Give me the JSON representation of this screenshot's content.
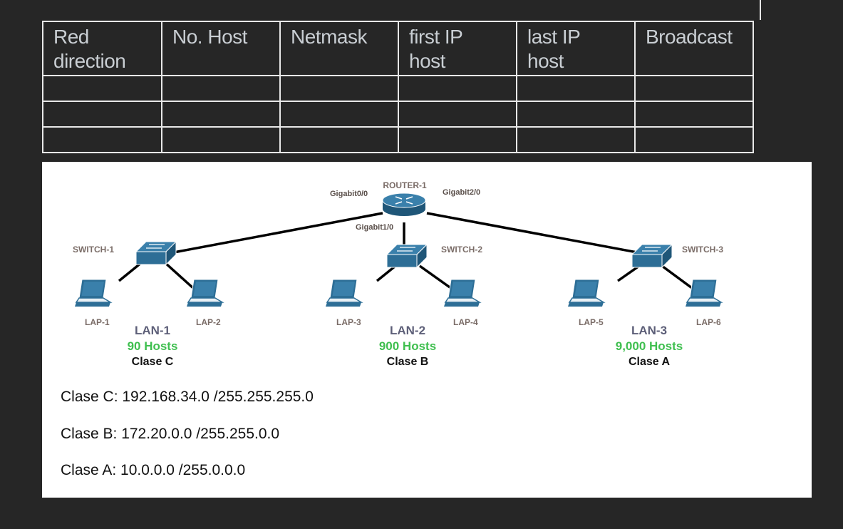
{
  "table": {
    "headers": [
      "Red\ndirection",
      "No. Host",
      "Netmask",
      "first IP\nhost",
      "last IP\nhost",
      "Broadcast"
    ],
    "header_lines": [
      [
        "Red",
        "direction"
      ],
      [
        "No. Host"
      ],
      [
        "Netmask"
      ],
      [
        "first IP",
        "host"
      ],
      [
        "last IP",
        "host"
      ],
      [
        "Broadcast"
      ]
    ],
    "rows": [
      [
        "",
        "",
        "",
        "",
        "",
        ""
      ],
      [
        "",
        "",
        "",
        "",
        "",
        ""
      ],
      [
        "",
        "",
        "",
        "",
        "",
        ""
      ]
    ]
  },
  "diagram": {
    "router": {
      "name": "ROUTER-1",
      "interfaces": [
        "Gigabit0/0",
        "Gigabit1/0",
        "Gigabit2/0"
      ]
    },
    "switches": [
      "SWITCH-1",
      "SWITCH-2",
      "SWITCH-3"
    ],
    "laptops": [
      "LAP-1",
      "LAP-2",
      "LAP-3",
      "LAP-4",
      "LAP-5",
      "LAP-6"
    ],
    "lans": [
      {
        "name": "LAN-1",
        "hosts": "90 Hosts",
        "clase": "Clase C"
      },
      {
        "name": "LAN-2",
        "hosts": "900 Hosts",
        "clase": "Clase B"
      },
      {
        "name": "LAN-3",
        "hosts": "9,000 Hosts",
        "clase": "Clase A"
      }
    ],
    "colors": {
      "device": "#2d6e96",
      "hosts": "#3fbf4f",
      "link": "#000000"
    }
  },
  "info": [
    "Clase C: 192.168.34.0 /255.255.255.0",
    "Clase B: 172.20.0.0 /255.255.0.0",
    "Clase A: 10.0.0.0 /255.0.0.0"
  ]
}
